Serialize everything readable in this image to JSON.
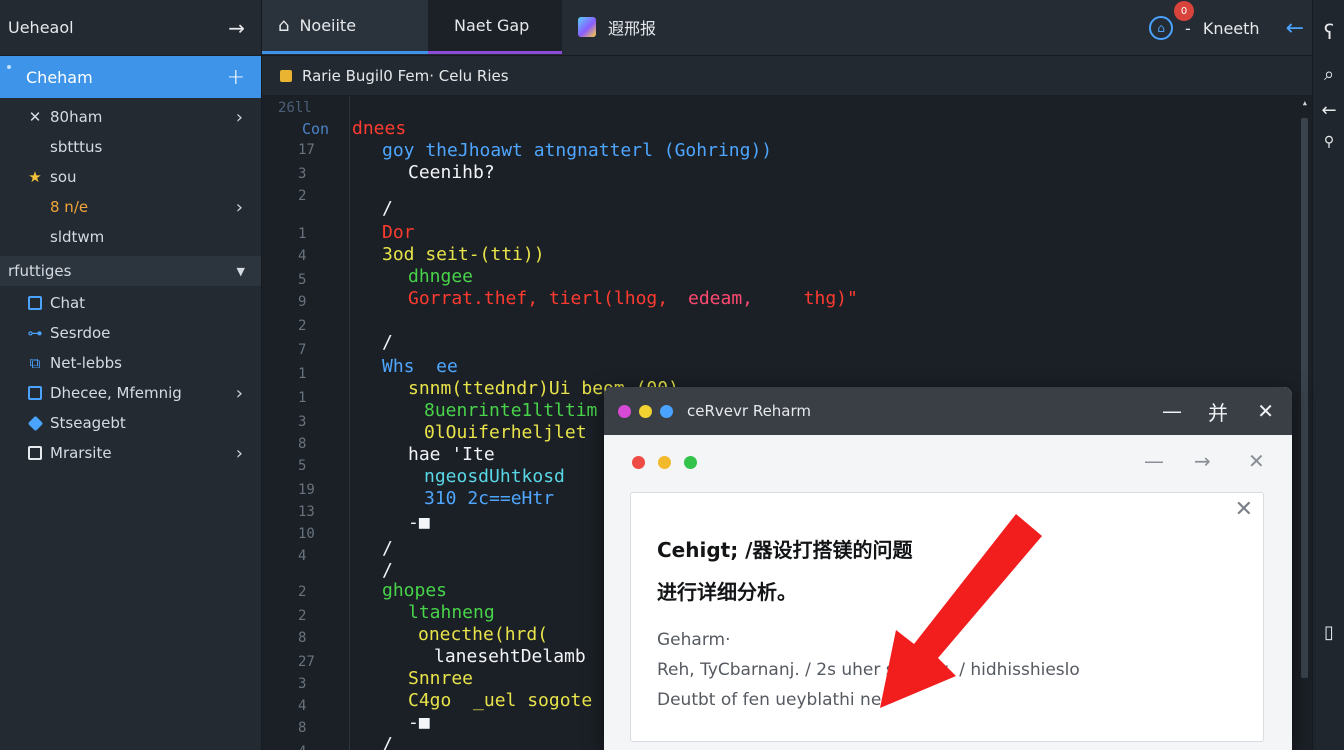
{
  "sidebar": {
    "header_title": "Ueheaol",
    "active_item": "Cheham",
    "items": [
      {
        "label": "80ham",
        "icon": "close-icon"
      },
      {
        "label": "sbtttus",
        "icon": ""
      },
      {
        "label": "sou",
        "icon": "star-icon"
      },
      {
        "label": "8 n/e",
        "icon": ""
      },
      {
        "label": "sldtwm",
        "icon": ""
      }
    ],
    "section_title": "rfuttiges",
    "section_items": [
      {
        "label": "Chat",
        "icon": "window-icon"
      },
      {
        "label": "Sesrdoe",
        "icon": "hierarchy-icon"
      },
      {
        "label": "Net-lebbs",
        "icon": "network-icon"
      },
      {
        "label": "Dhecee, Mfemnig",
        "icon": "window-icon"
      },
      {
        "label": "Stseagebt",
        "icon": "diamond-icon"
      },
      {
        "label": "Mrarsite",
        "icon": "image-icon"
      }
    ]
  },
  "tabs": [
    {
      "label": "Noeiite",
      "icon": "chat-icon"
    },
    {
      "label": "Naet Gap",
      "icon": ""
    },
    {
      "label": "遐邢报",
      "icon": "gem-icon"
    }
  ],
  "topright": {
    "label": "Kneeth",
    "badge": "0",
    "dash": "-"
  },
  "breadcrumb": "Rarie  Bugil0 Fem·  Celu  Ries",
  "editor": {
    "header_label_1": "26ll",
    "header_label_2": "Con",
    "keyword": "dnees",
    "line_numbers": [
      "17",
      "3",
      "2",
      "1",
      "4",
      "5",
      "9",
      "2",
      "7",
      "1",
      "1",
      "3",
      "8",
      "5",
      "19",
      "13",
      "10",
      "4",
      "2",
      "2",
      "8",
      "27",
      "3",
      "4",
      "8",
      "4"
    ],
    "lines": [
      {
        "text": "goy theJhoawt atngnatterl (Gohring))",
        "color": "blue"
      },
      {
        "text": "Ceenihb?",
        "color": "white"
      },
      {
        "text": "/",
        "color": "white"
      },
      {
        "text": "Dor",
        "color": "red"
      },
      {
        "text": "3od seit-(tti))",
        "color": "yellow"
      },
      {
        "text": "dhngee",
        "color": "green"
      },
      {
        "text": "Gorrat.thef, tierl(lhog, ",
        "color": "red"
      },
      {
        "text": "edeam,",
        "color": "pink"
      },
      {
        "text": "  thg)\"",
        "color": "red"
      },
      {
        "text": "/",
        "color": "white"
      },
      {
        "text": "Whs  ee",
        "color": "blue"
      },
      {
        "text": "snnm(ttedndr)Ui beom (00)",
        "color": "yellow"
      },
      {
        "text": "8uenrinte1ltltim",
        "color": "green"
      },
      {
        "text": "0lOuiferheljlet",
        "color": "yellow"
      },
      {
        "text": "hae 'Ite",
        "color": "white"
      },
      {
        "text": "ngeosdUhtkosd",
        "color": "cyan"
      },
      {
        "text": "310 2c==eHtr",
        "color": "blue"
      },
      {
        "text": "-■",
        "color": "white"
      },
      {
        "text": "/",
        "color": "white"
      },
      {
        "text": "/",
        "color": "white"
      },
      {
        "text": "ghopes",
        "color": "green"
      },
      {
        "text": "ltahneng",
        "color": "green"
      },
      {
        "text": "onecthe(hrd(",
        "color": "yellow"
      },
      {
        "text": "lanesehtDelamb",
        "color": "white"
      },
      {
        "text": "Snnree",
        "color": "yellow"
      },
      {
        "text": "C4go  _uel sogote",
        "color": "yellow"
      },
      {
        "text": "-■",
        "color": "white"
      },
      {
        "text": "/",
        "color": "white"
      }
    ]
  },
  "dialog": {
    "title": "ceRvevr Reharm",
    "max_glyph": "并",
    "card_title_line1": "Cehigt; /器设打搭镁的问题",
    "card_title_line2": "进行详细分析。",
    "meta_line1": "Geharm·",
    "meta_line2": "Reh, TyCbarnanj. / 2s   uher s tehoy, / hidhisshieslo",
    "meta_line3": "Deutbt of fen ueyblathi ne."
  },
  "colors": {
    "accent": "#3d94e8",
    "purple_tab": "#8c4cd8",
    "red_arrow": "#f21d1d",
    "badge": "#d8433b"
  }
}
